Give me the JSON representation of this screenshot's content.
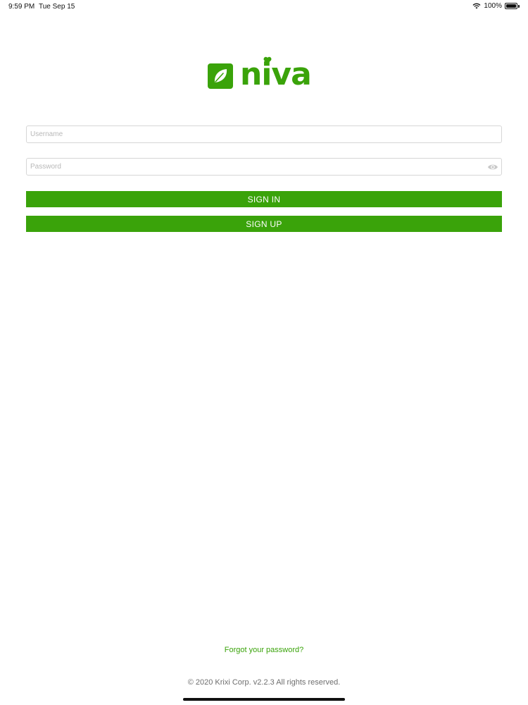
{
  "status_bar": {
    "time": "9:59 PM",
    "date": "Tue Sep 15",
    "battery": "100%",
    "icons": [
      "wifi-icon",
      "battery-icon"
    ]
  },
  "logo": {
    "wordmark": "niva",
    "icons": [
      "leaf-icon",
      "heart-icon"
    ]
  },
  "form": {
    "username_placeholder": "Username",
    "username_value": "",
    "password_placeholder": "Password",
    "password_value": "",
    "signin_label": "SIGN IN",
    "signup_label": "SIGN UP"
  },
  "footer": {
    "forgot_label": "Forgot your password?",
    "copyright": "© 2020 Krixi Corp. v2.2.3 All rights reserved."
  },
  "colors": {
    "brand": "#3aa30a",
    "field_border": "#d6d6d6",
    "placeholder": "#b8b8b8",
    "copyright_text": "#6e6e6e"
  }
}
